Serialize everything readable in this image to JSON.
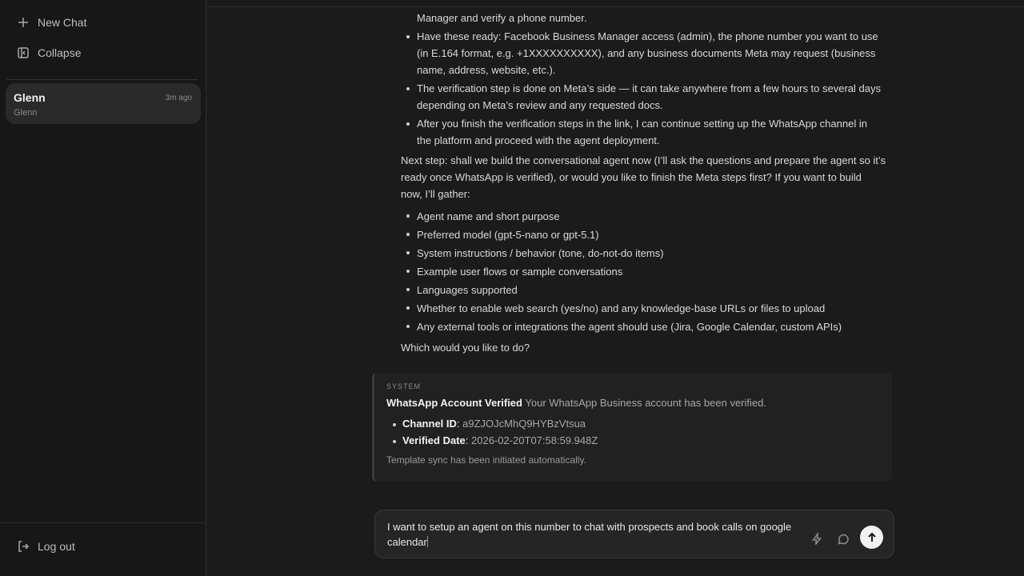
{
  "sidebar": {
    "new_chat": "New Chat",
    "collapse": "Collapse",
    "logout": "Log out",
    "chats": [
      {
        "name": "Glenn",
        "time": "3m ago",
        "subtitle": "Glenn"
      }
    ]
  },
  "conversation": {
    "first_line": "Manager and verify a phone number.",
    "bullets_a": [
      [
        "Have these ready: Facebook Business Manager access (admin), the phone number you want to use",
        "(in E.164 format, e.g. +1XXXXXXXXXX), and any business documents Meta may request (business",
        "name, address, website, etc.)."
      ],
      [
        "The verification step is done on Meta’s side — it can take anywhere from a few hours to several days",
        "depending on Meta’s review and any requested docs."
      ],
      [
        "After you finish the verification steps in the link, I can continue setting up the WhatsApp channel in",
        "the platform and proceed with the agent deployment."
      ]
    ],
    "next_step": [
      "Next step: shall we build the conversational agent now (I’ll ask the questions and prepare the agent so it’s",
      "ready once WhatsApp is verified), or would you like to finish the Meta steps first? If you want to build",
      "now, I’ll gather:"
    ],
    "bullets_b": [
      "Agent name and short purpose",
      "Preferred model (gpt-5-nano or gpt-5.1)",
      "System instructions / behavior (tone, do-not-do items)",
      "Example user flows or sample conversations",
      "Languages supported",
      "Whether to enable web search (yes/no) and any knowledge-base URLs or files to upload",
      "Any external tools or integrations the agent should use (Jira, Google Calendar, custom APIs)"
    ],
    "closing": "Which would you like to do?"
  },
  "system_card": {
    "label": "SYSTEM",
    "title": "WhatsApp Account Verified",
    "title_rest": "Your WhatsApp Business account has been verified.",
    "channel_id_label": "Channel ID",
    "channel_id_value": "a9ZJOJcMhQ9HYBzVtsua",
    "verified_date_label": "Verified Date",
    "verified_date_value": "2026-02-20T07:58:59.948Z",
    "note": "Template sync has been initiated automatically."
  },
  "composer": {
    "line1": "I want to setup an agent on this number to chat with prospects and book calls on google",
    "line2": "calendar"
  },
  "colors": {
    "background": "#1b1b1b",
    "sidebar": "#171717",
    "active_chat": "#2a2a2a",
    "send_button": "#f2f2f2",
    "caret": "#2ecc71"
  }
}
